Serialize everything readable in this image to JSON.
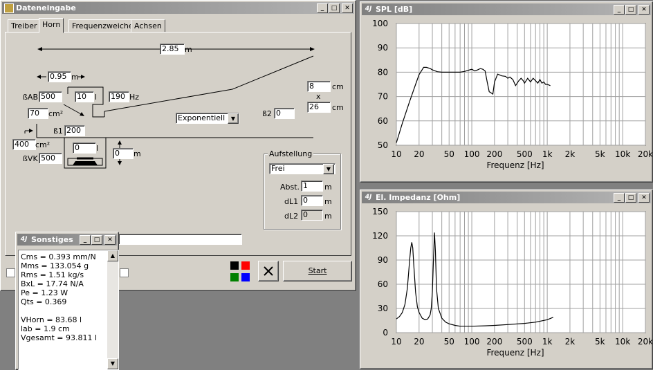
{
  "main_window": {
    "title": "Dateneingabe",
    "tabs": [
      "Treiber",
      "Horn",
      "Frequenzweiche",
      "Achsen"
    ],
    "active_tab": "Horn",
    "length_value": "2.85",
    "length_unit": "m",
    "mouth_dist_value": "0.95",
    "mouth_dist_unit": "m",
    "bab_label": "ßAB",
    "bab_value": "500",
    "volume_value": "10",
    "volume_unit": "l",
    "freq_value": "190",
    "freq_unit": "Hz",
    "width_value": "8",
    "width_unit": "cm",
    "times": "x",
    "height_value": "26",
    "height_unit": "cm",
    "throat_area_value": "70",
    "throat_area_unit": "cm²",
    "flare_type": "Exponentiell",
    "b2_label": "ß2",
    "b2_value": "0",
    "b1_label": "ß1",
    "b1_value": "200",
    "sd_value": "400",
    "sd_unit": "cm²",
    "vk_value": "0",
    "vk_unit": "l",
    "offset_value": "0",
    "offset_unit": "m",
    "bvk_label": "ßVK",
    "bvk_value": "500",
    "aufstellung": {
      "title": "Aufstellung",
      "mode": "Frei",
      "abst_label": "Abst.",
      "abst_value": "1",
      "abst_unit": "m",
      "dl1_label": "dL1",
      "dl1_value": "0",
      "dl1_unit": "m",
      "dl2_label": "dL2",
      "dl2_value": "0",
      "dl2_unit": "m"
    },
    "start_label": "Start",
    "colors": {
      "black": "#000000",
      "red": "#ff0000",
      "green": "#008000",
      "blue": "#0000ff"
    }
  },
  "sonstiges": {
    "title": "Sonstiges",
    "lines": [
      "Cms = 0.393 mm/N",
      "Mms = 133.054 g",
      "Rms = 1.51 kg/s",
      "BxL = 17.74 N/A",
      "Pe = 1.23 W",
      "Qts = 0.369",
      "",
      "VHorn = 83.68 l",
      "lab = 1.9 cm",
      "Vgesamt = 93.811 l"
    ]
  },
  "chart_data": [
    {
      "type": "line",
      "title": "SPL [dB]",
      "xlabel": "Frequenz [Hz]",
      "ylabel": "",
      "xscale": "log",
      "xlim": [
        10,
        20000
      ],
      "ylim": [
        50,
        100
      ],
      "yticks": [
        "100",
        "90",
        "80",
        "70",
        "60",
        "50"
      ],
      "xticks": [
        "10",
        "20",
        "50",
        "100",
        "200",
        "500",
        "1k",
        "2k",
        "5k",
        "10k",
        "20k"
      ],
      "grid": true,
      "series": [
        {
          "x": [
            10,
            12,
            15,
            18,
            20,
            23,
            25,
            28,
            30,
            35,
            40,
            50,
            60,
            70,
            80,
            90,
            100,
            110,
            120,
            130,
            140,
            150,
            160,
            170,
            180,
            190,
            200,
            220,
            250,
            280,
            300,
            320,
            350,
            380,
            400,
            420,
            450,
            480,
            500,
            550,
            600,
            650,
            700,
            750,
            800,
            850,
            900,
            950,
            1000,
            1100
          ],
          "y": [
            51,
            59,
            68,
            75,
            79,
            82,
            82,
            81.5,
            81,
            80.2,
            80,
            80,
            80,
            80,
            80.3,
            80.8,
            81.2,
            80.5,
            81,
            81.5,
            81.2,
            80.5,
            76,
            72,
            71.5,
            71,
            76,
            79.2,
            78.5,
            78.3,
            77.5,
            78,
            77,
            74.5,
            75.5,
            76.5,
            77.5,
            76.5,
            75.5,
            77.5,
            76,
            77.5,
            76.5,
            75.5,
            77,
            75.5,
            76,
            75,
            75,
            74.5
          ]
        }
      ]
    },
    {
      "type": "line",
      "title": "El. Impedanz [Ohm]",
      "xlabel": "Frequenz [Hz]",
      "ylabel": "",
      "xscale": "log",
      "xlim": [
        10,
        20000
      ],
      "ylim": [
        0,
        150
      ],
      "yticks": [
        "150",
        "120",
        "90",
        "60",
        "30",
        "0"
      ],
      "xticks": [
        "10",
        "20",
        "50",
        "100",
        "200",
        "500",
        "1k",
        "2k",
        "5k",
        "10k",
        "20k"
      ],
      "grid": true,
      "series": [
        {
          "x": [
            10,
            11,
            12,
            13,
            14,
            15,
            15.5,
            16,
            16.5,
            17,
            18,
            19,
            20,
            22,
            24,
            26,
            28,
            29,
            30,
            31,
            32,
            33,
            34,
            36,
            40,
            45,
            50,
            60,
            70,
            80,
            100,
            150,
            200,
            300,
            500,
            700,
            1000,
            1200
          ],
          "y": [
            17,
            20,
            25,
            35,
            55,
            90,
            105,
            112,
            105,
            85,
            50,
            32,
            25,
            18,
            16,
            17,
            22,
            30,
            50,
            90,
            124,
            100,
            55,
            30,
            18,
            13,
            11,
            9,
            8,
            8,
            8,
            8.5,
            9,
            10,
            11.5,
            13,
            16,
            19
          ]
        }
      ]
    }
  ]
}
